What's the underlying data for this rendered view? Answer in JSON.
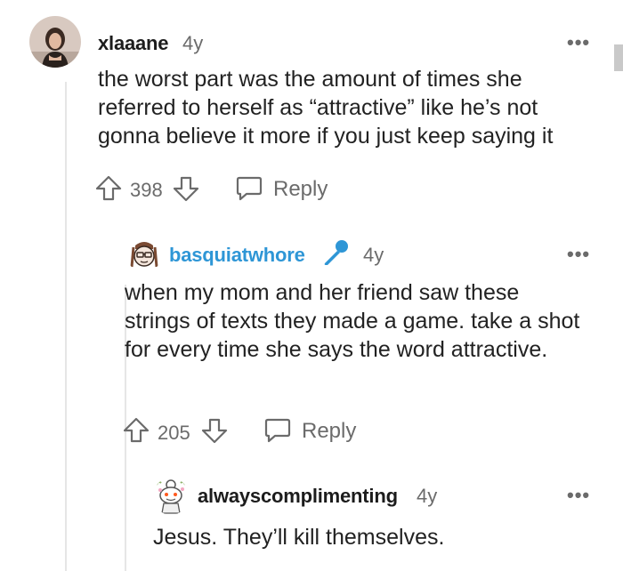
{
  "comments": [
    {
      "username": "xlaaane",
      "age": "4y",
      "text": "the worst part was the amount of times she referred to herself as “attractive” like he’s not gonna believe it more if you just keep saying it",
      "votes": "398",
      "reply_label": "Reply",
      "more_label": "•••",
      "avatar_icon": "user-photo-avatar"
    },
    {
      "username": "basquiatwhore",
      "age": "4y",
      "text": "when my mom and her friend saw these strings of texts they made a game. take a shot for every time she says the word attractive.",
      "votes": "205",
      "reply_label": "Reply",
      "more_label": "•••",
      "avatar_icon": "snoo-avatar",
      "flair_icon": "microphone-icon"
    },
    {
      "username": "alwayscomplimenting",
      "age": "4y",
      "text": "Jesus. They’ll kill themselves.",
      "more_label": "•••",
      "avatar_icon": "snoo-avatar"
    }
  ],
  "colors": {
    "username_blue": "#2e96d6",
    "muted": "#6b6b6b",
    "thread_line": "#e6e6e6"
  }
}
